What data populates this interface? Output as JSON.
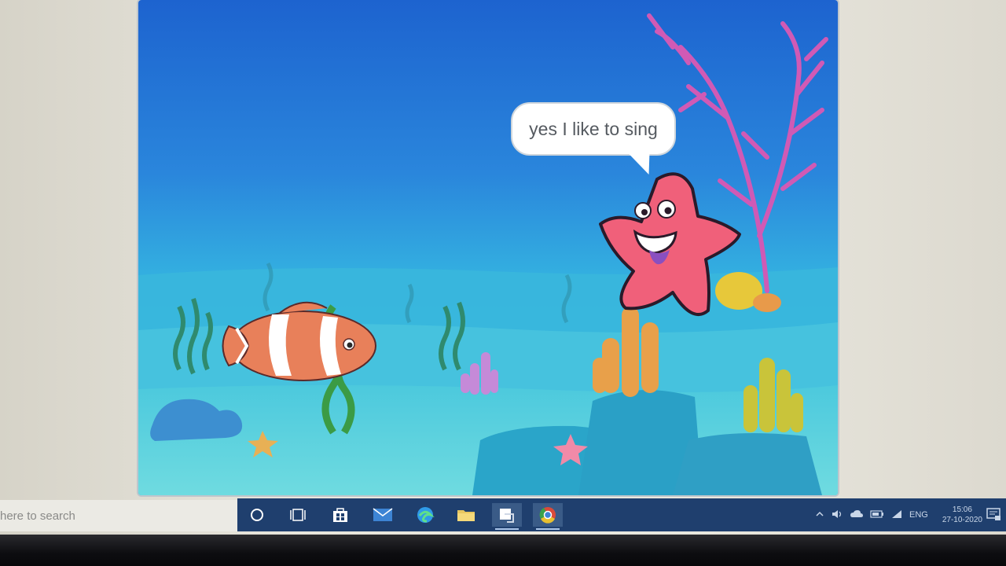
{
  "stage": {
    "speech_bubble": "yes I like to sing"
  },
  "sprites": [
    "clownfish",
    "starfish"
  ],
  "taskbar": {
    "search_placeholder": "here to search",
    "icons": [
      "cortana-icon",
      "task-view-icon",
      "store-icon",
      "mail-icon",
      "edge-icon",
      "file-explorer-icon",
      "app-icon",
      "chrome-icon"
    ],
    "tray": {
      "language": "ENG",
      "time": "15:06",
      "date": "27-10-2020"
    }
  },
  "colors": {
    "water_top": "#1f6fd6",
    "water_bottom": "#39c4e4",
    "sand": "#5fd2d9",
    "taskbar": "#1f3f6e",
    "starfish": "#f0607a",
    "clownfish": "#e8805a",
    "coral_pink": "#d65ab8"
  }
}
